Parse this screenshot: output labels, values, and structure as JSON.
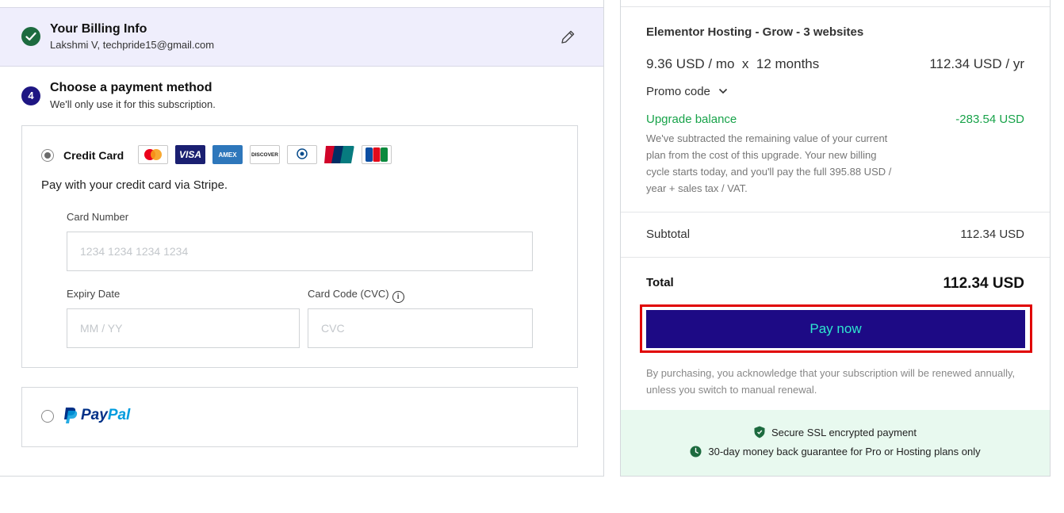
{
  "billing": {
    "title": "Your Billing Info",
    "subtitle": "Lakshmi V, techpride15@gmail.com"
  },
  "payment_step": {
    "number": "4",
    "title": "Choose a payment method",
    "subtitle": "We'll only use it for this subscription."
  },
  "credit_card": {
    "label": "Credit Card",
    "description": "Pay with your credit card via Stripe.",
    "card_brands": [
      "mastercard",
      "VISA",
      "AMEX",
      "DISCOVER",
      "Diners Club",
      "UnionPay",
      "JCB"
    ],
    "card_number_label": "Card Number",
    "card_number_placeholder": "1234 1234 1234 1234",
    "expiry_label": "Expiry Date",
    "expiry_placeholder": "MM / YY",
    "cvc_label": "Card Code (CVC)",
    "cvc_placeholder": "CVC",
    "selected": true
  },
  "paypal": {
    "label_pay": "Pay",
    "label_pal": "Pal",
    "selected": false
  },
  "order": {
    "product_name": "Elementor Hosting - Grow - 3 websites",
    "price_per_month": "9.36 USD / mo  x  12 months",
    "price_per_year": "112.34 USD / yr",
    "promo_label": "Promo code",
    "upgrade_label": "Upgrade balance",
    "upgrade_amount": "-283.54 USD",
    "upgrade_note": "We've subtracted the remaining value of your current plan from the cost of this upgrade. Your new billing cycle starts today, and you'll pay the full 395.88 USD / year + sales tax / VAT.",
    "subtotal_label": "Subtotal",
    "subtotal_value": "112.34 USD",
    "total_label": "Total",
    "total_value": "112.34 USD",
    "pay_button": "Pay now",
    "legal": "By purchasing, you acknowledge that your subscription will be renewed annually, unless you switch to manual renewal.",
    "trust_ssl": "Secure SSL encrypted payment",
    "trust_guarantee": "30-day money back guarantee for Pro or Hosting plans only"
  },
  "colors": {
    "accent_navy": "#1d0a85",
    "button_text": "#2ee6d0",
    "success_green": "#18a34a",
    "highlight_red": "#e00000",
    "billing_bg": "#efeefc",
    "trust_bg": "#e8f9ef"
  },
  "icons": {
    "billing_status": "check-icon",
    "edit": "pencil-icon",
    "promo": "chevron-down-icon",
    "cvc_help": "info-icon",
    "ssl": "shield-icon",
    "guarantee": "clock-icon"
  }
}
